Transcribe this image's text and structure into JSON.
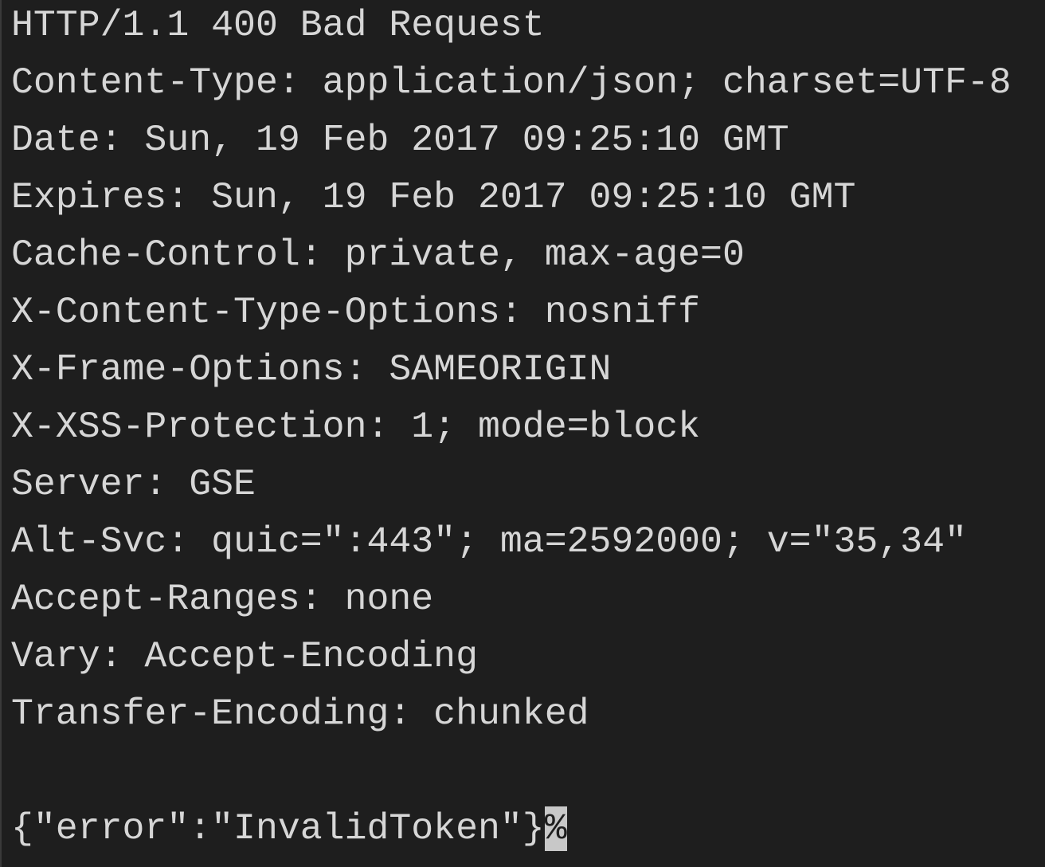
{
  "terminal": {
    "lines": [
      "HTTP/1.1 400 Bad Request",
      "Content-Type: application/json; charset=UTF-8",
      "Date: Sun, 19 Feb 2017 09:25:10 GMT",
      "Expires: Sun, 19 Feb 2017 09:25:10 GMT",
      "Cache-Control: private, max-age=0",
      "X-Content-Type-Options: nosniff",
      "X-Frame-Options: SAMEORIGIN",
      "X-XSS-Protection: 1; mode=block",
      "Server: GSE",
      "Alt-Svc: quic=\":443\"; ma=2592000; v=\"35,34\"",
      "Accept-Ranges: none",
      "Vary: Accept-Encoding",
      "Transfer-Encoding: chunked"
    ],
    "body": "{\"error\":\"InvalidToken\"}",
    "no_newline_marker": "%",
    "colors": {
      "background": "#1e1e1e",
      "text": "#d6d6d6",
      "marker_background": "#c8c8c8"
    }
  }
}
